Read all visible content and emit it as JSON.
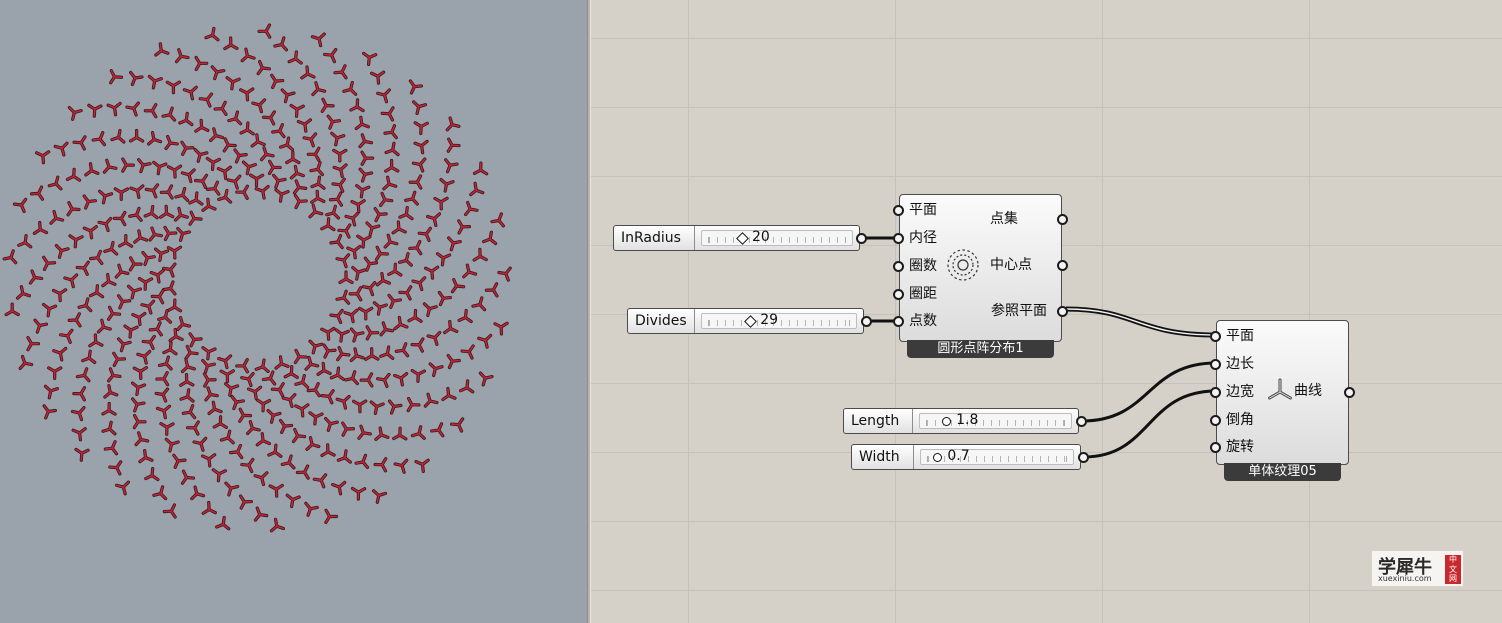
{
  "viewport": {
    "background": "#9aa2ab",
    "pattern_color": "#c0243a",
    "pattern_outline": "#3a1a1a",
    "pattern_shape": "tri-arm-curve",
    "rings": 14,
    "points_per_ring": 29
  },
  "canvas": {
    "background": "#d5d1c9",
    "grid_color": "#c6c2ba"
  },
  "sliders": [
    {
      "label": "InRadius",
      "value": "20",
      "grip": "diamond",
      "fraction": 0.25
    },
    {
      "label": "Divides",
      "value": "29",
      "grip": "diamond",
      "fraction": 0.3
    },
    {
      "label": "Length",
      "value": "1.8",
      "grip": "round",
      "fraction": 0.15
    },
    {
      "label": "Width",
      "value": "0.7",
      "grip": "round",
      "fraction": 0.08
    }
  ],
  "component_circle": {
    "caption": "圆形点阵分布1",
    "icon": "circular-dots-icon",
    "inputs": [
      "平面",
      "内径",
      "圈数",
      "圈距",
      "点数"
    ],
    "outputs": [
      "点集",
      "中心点",
      "参照平面"
    ]
  },
  "component_texture": {
    "caption": "单体纹理05",
    "icon": "tri-arm-icon",
    "inputs": [
      "平面",
      "边长",
      "边宽",
      "倒角",
      "旋转"
    ],
    "outputs": [
      "曲线"
    ]
  },
  "watermark": {
    "title": "学犀牛",
    "url": "xuexiniu.com",
    "seal": [
      "中",
      "文",
      "网"
    ]
  }
}
